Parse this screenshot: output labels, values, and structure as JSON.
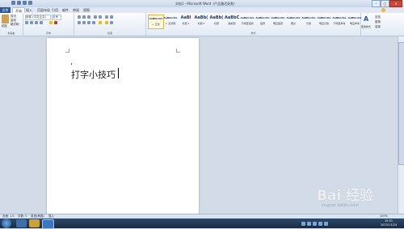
{
  "window": {
    "title": "文档1 - Microsoft Word（产品激活失败）",
    "minimize": "–",
    "maximize": "□",
    "close": "✕"
  },
  "tabs": {
    "file": "文件",
    "items": [
      "开始",
      "插入",
      "页面布局",
      "引用",
      "邮件",
      "审阅",
      "视图"
    ],
    "active": "开始"
  },
  "ribbon": {
    "clipboard": {
      "paste": "粘贴",
      "cut": "剪切",
      "copy": "复制",
      "format_painter": "格式刷",
      "label": "剪贴板"
    },
    "font": {
      "font_name": "宋体 (中文正文)",
      "font_size": "五号",
      "label": "字体"
    },
    "paragraph": {
      "label": "段落"
    },
    "styles": {
      "label": "样式",
      "items": [
        {
          "sample": "AaBbCcDc",
          "name": "↵ 正文"
        },
        {
          "sample": "AaBbCcDc",
          "name": "↵ 无间隔"
        },
        {
          "sample": "AaBl",
          "name": "标题 1"
        },
        {
          "sample": "AaBb(",
          "name": "标题 2"
        },
        {
          "sample": "AaBb(",
          "name": "标题"
        },
        {
          "sample": "AaBbC",
          "name": "副标题"
        },
        {
          "sample": "AaBbCcDc",
          "name": "不明显强调"
        },
        {
          "sample": "AaBbCcDc",
          "name": "强调"
        },
        {
          "sample": "AaBbCcDc",
          "name": "明显强调"
        },
        {
          "sample": "AaBbCcDc",
          "name": "要点"
        },
        {
          "sample": "AaBbCcDc",
          "name": "引用"
        },
        {
          "sample": "AaBbCcDc",
          "name": "明显引用"
        },
        {
          "sample": "AaBbCcDc",
          "name": "不明显参考"
        },
        {
          "sample": "AaBbCcDc",
          "name": "明显参考"
        }
      ]
    },
    "change_styles": "更改样式",
    "editing": {
      "find": "查找",
      "replace": "替换",
      "select": "选择",
      "label": "编辑"
    }
  },
  "document": {
    "text": "打字小技巧"
  },
  "statusbar": {
    "page": "页面: 1/1",
    "words": "字数: 5",
    "language": "英语(美国)",
    "mode": "插入",
    "zoom": "100%"
  },
  "taskbar": {
    "time": "15:51",
    "date": "2015/11/24"
  },
  "watermark": {
    "logo": "Bai 经验",
    "url": "jingyan.baidu.com"
  },
  "colors": {
    "file_tab": "#2a579a",
    "close": "#c9483b",
    "taskbar": "#1d3350"
  }
}
